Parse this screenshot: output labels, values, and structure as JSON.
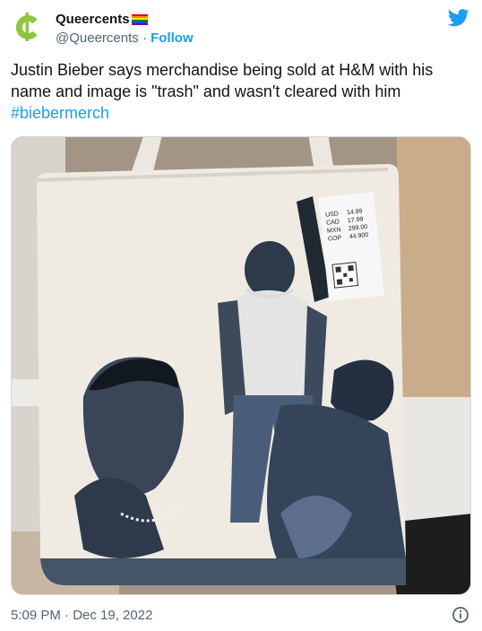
{
  "author": {
    "display_name": "Queercents",
    "handle": "@Queercents",
    "separator": "·",
    "follow_label": "Follow"
  },
  "tweet": {
    "text": "Justin Bieber says merchandise being sold at H&M with his name and image is \"trash\" and wasn't cleared with him",
    "hashtag": "#biebermerch"
  },
  "tag": {
    "currencies": [
      "USD",
      "CAD",
      "MXN",
      "COP"
    ],
    "prices": [
      "14.99",
      "17.99",
      "299.00",
      "44.900"
    ]
  },
  "footer": {
    "timestamp": "5:09 PM · Dec 19, 2022"
  },
  "icons": {
    "avatar": "cent-sign-logo",
    "brand": "twitter-bird-icon",
    "info": "info-icon"
  },
  "colors": {
    "link": "#1d9bf0",
    "secondary_text": "#536471",
    "avatar_green": "#8cc63f"
  }
}
